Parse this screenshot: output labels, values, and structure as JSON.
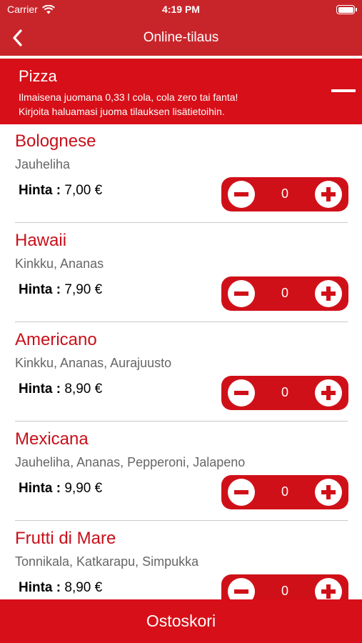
{
  "status": {
    "carrier": "Carrier",
    "time": "4:19 PM",
    "wifi_icon": "wifi-icon",
    "battery_icon": "battery-icon"
  },
  "nav": {
    "title": "Online-tilaus",
    "back_icon": "chevron-left-icon"
  },
  "section": {
    "title": "Pizza",
    "note_line1": "Ilmaisena juomana 0,33 l cola, cola zero tai fanta!",
    "note_line2": "Kirjoita haluamasi juoma tilauksen lisätietoihin.",
    "collapse_icon": "minus-icon"
  },
  "colors": {
    "primary": "#c8252b",
    "accent": "#d70f18",
    "item_title": "#c8101a"
  },
  "items": [
    {
      "name": "Bolognese",
      "desc": "Jauheliha",
      "price_label": "Hinta :",
      "price": "7,00 €",
      "qty": "0"
    },
    {
      "name": "Hawaii",
      "desc": "Kinkku, Ananas",
      "price_label": "Hinta :",
      "price": "7,90 €",
      "qty": "0"
    },
    {
      "name": "Americano",
      "desc": "Kinkku, Ananas, Aurajuusto",
      "price_label": "Hinta :",
      "price": "8,90 €",
      "qty": "0"
    },
    {
      "name": "Mexicana",
      "desc": "Jauheliha, Ananas, Pepperoni, Jalapeno",
      "price_label": "Hinta :",
      "price": "9,90 €",
      "qty": "0"
    },
    {
      "name": "Frutti di Mare",
      "desc": "Tonnikala, Katkarapu, Simpukka",
      "price_label": "Hinta :",
      "price": "8,90 €",
      "qty": "0"
    }
  ],
  "cart": {
    "label": "Ostoskori"
  }
}
